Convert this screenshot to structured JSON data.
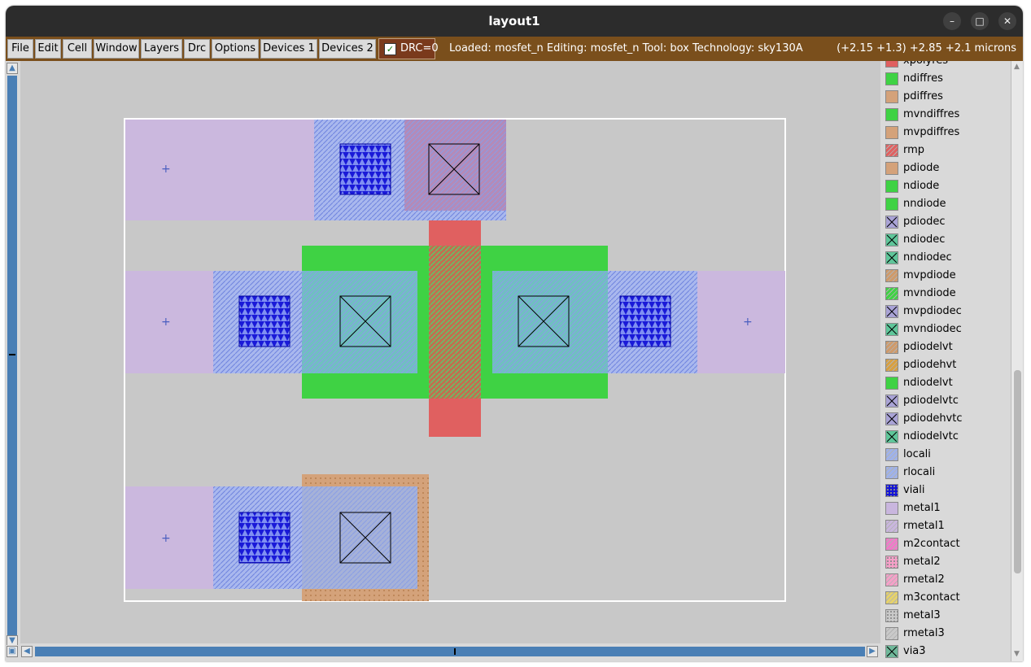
{
  "window": {
    "title": "layout1",
    "minimize": "–",
    "maximize": "□",
    "close": "✕"
  },
  "menu": [
    "File",
    "Edit",
    "Cell",
    "Window",
    "Layers",
    "Drc",
    "Options",
    "Devices 1",
    "Devices 2"
  ],
  "drc": {
    "label": "DRC=0",
    "checked": true
  },
  "status": "Loaded: mosfet_n  Editing: mosfet_n  Tool: box   Technology: sky130A",
  "coords": "(+2.15 +1.3) +2.85 +2.1 microns",
  "colors": {
    "menubar": "#7a4f1c",
    "metal1": "#c9b6de",
    "locali": "#9fb2ea",
    "viali": "#1414d6",
    "diff": "#3fd244",
    "poly": "#e06060",
    "pdiff": "#cf9a6a"
  },
  "layers": [
    {
      "name": "xpolyres",
      "color": "#e06060",
      "icon": "solid"
    },
    {
      "name": "ndiffres",
      "color": "#3fd244",
      "icon": "solid"
    },
    {
      "name": "pdiffres",
      "color": "#d4a27a",
      "icon": "solid"
    },
    {
      "name": "mvndiffres",
      "color": "#3fd244",
      "icon": "solid"
    },
    {
      "name": "mvpdiffres",
      "color": "#d4a27a",
      "icon": "solid"
    },
    {
      "name": "rmp",
      "color": "#e06060",
      "icon": "hatch"
    },
    {
      "name": "pdiode",
      "color": "#d4a27a",
      "icon": "solid"
    },
    {
      "name": "ndiode",
      "color": "#3fd244",
      "icon": "solid"
    },
    {
      "name": "nndiode",
      "color": "#3fd244",
      "icon": "solid"
    },
    {
      "name": "pdiodec",
      "color": "#a9a3d6",
      "icon": "cross"
    },
    {
      "name": "ndiodec",
      "color": "#5fc69a",
      "icon": "cross"
    },
    {
      "name": "nndiodec",
      "color": "#5fc69a",
      "icon": "cross"
    },
    {
      "name": "mvpdiode",
      "color": "#cf9a6a",
      "icon": "hatch"
    },
    {
      "name": "mvndiode",
      "color": "#3fd244",
      "icon": "hatch"
    },
    {
      "name": "mvpdiodec",
      "color": "#a9a3d6",
      "icon": "cross"
    },
    {
      "name": "mvndiodec",
      "color": "#5fc69a",
      "icon": "cross"
    },
    {
      "name": "pdiodelvt",
      "color": "#cf9a6a",
      "icon": "hatch"
    },
    {
      "name": "pdiodehvt",
      "color": "#d8a040",
      "icon": "hatch"
    },
    {
      "name": "ndiodelvt",
      "color": "#3fd244",
      "icon": "solid"
    },
    {
      "name": "pdiodelvtc",
      "color": "#a9a3d6",
      "icon": "cross"
    },
    {
      "name": "pdiodehvtc",
      "color": "#a9a3d6",
      "icon": "cross"
    },
    {
      "name": "ndiodelvtc",
      "color": "#5fc69a",
      "icon": "cross"
    },
    {
      "name": "locali",
      "color": "#9fb2ea",
      "icon": "hatch"
    },
    {
      "name": "rlocali",
      "color": "#9fb2ea",
      "icon": "hatch"
    },
    {
      "name": "viali",
      "color": "#1414d6",
      "icon": "dots"
    },
    {
      "name": "metal1",
      "color": "#c9b6de",
      "icon": "solid"
    },
    {
      "name": "rmetal1",
      "color": "#c9b6de",
      "icon": "hatch"
    },
    {
      "name": "m2contact",
      "color": "#f07ac8",
      "icon": "hatch"
    },
    {
      "name": "metal2",
      "color": "#f5a0c8",
      "icon": "dots"
    },
    {
      "name": "rmetal2",
      "color": "#f5a0c8",
      "icon": "hatch"
    },
    {
      "name": "m3contact",
      "color": "#e6d26a",
      "icon": "hatch"
    },
    {
      "name": "metal3",
      "color": "#c9c9c9",
      "icon": "dots"
    },
    {
      "name": "rmetal3",
      "color": "#c9c9c9",
      "icon": "hatch"
    },
    {
      "name": "via3",
      "color": "#6fb89a",
      "icon": "cross"
    }
  ]
}
